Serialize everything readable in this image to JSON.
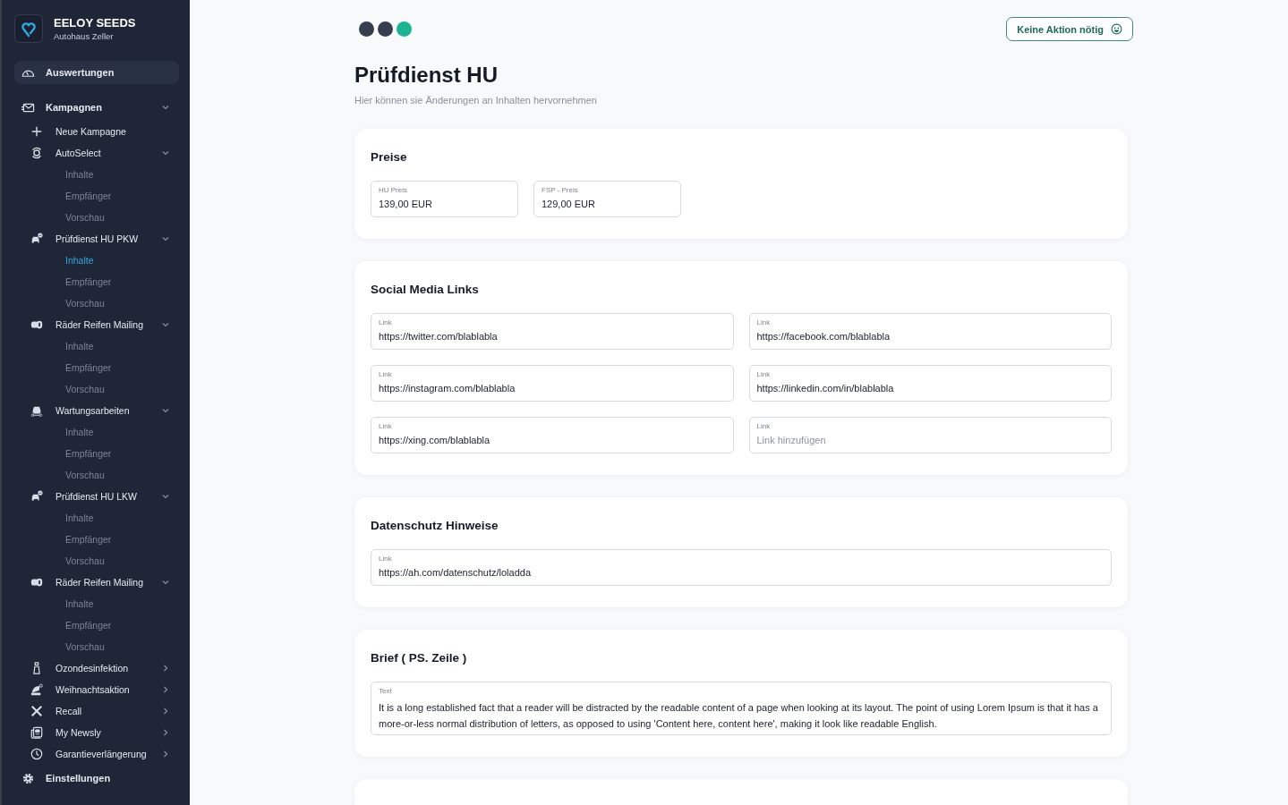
{
  "sidebar": {
    "brand": {
      "name": "EELOY SEEDS",
      "subtitle": "Autohaus Zeller"
    },
    "items": [
      {
        "label": "Auswertungen",
        "selected": true
      },
      {
        "label": "Kampagnen",
        "selected": false,
        "expanded": true,
        "children": [
          {
            "label": "Neue Kampagne"
          },
          {
            "label": "AutoSelect",
            "expanded": true,
            "children": [
              {
                "label": "Inhalte",
                "selected": false
              },
              {
                "label": "Empfänger",
                "selected": false
              },
              {
                "label": "Vorschau",
                "selected": false
              }
            ]
          },
          {
            "label": "Prüfdienst HU PKW",
            "expanded": true,
            "children": [
              {
                "label": "Inhalte",
                "selected": true
              },
              {
                "label": "Empfänger",
                "selected": false
              },
              {
                "label": "Vorschau",
                "selected": false
              }
            ]
          },
          {
            "label": "Räder Reifen Mailing",
            "expanded": true,
            "children": [
              {
                "label": "Inhalte",
                "selected": false
              },
              {
                "label": "Empfänger",
                "selected": false
              },
              {
                "label": "Vorschau",
                "selected": false
              }
            ]
          },
          {
            "label": "Wartungsarbeiten",
            "expanded": true,
            "children": [
              {
                "label": "Inhalte",
                "selected": false
              },
              {
                "label": "Empfänger",
                "selected": false
              },
              {
                "label": "Vorschau",
                "selected": false
              }
            ]
          },
          {
            "label": "Prüfdienst HU LKW",
            "expanded": true,
            "children": [
              {
                "label": "Inhalte",
                "selected": false
              },
              {
                "label": "Empfänger",
                "selected": false
              },
              {
                "label": "Vorschau",
                "selected": false
              }
            ]
          },
          {
            "label": "Räder Reifen Mailing",
            "expanded": true,
            "children": [
              {
                "label": "Inhalte",
                "selected": false
              },
              {
                "label": "Empfänger",
                "selected": false
              },
              {
                "label": "Vorschau",
                "selected": false
              }
            ]
          },
          {
            "label": "Ozondesinfektion",
            "expanded": false
          },
          {
            "label": "Weihnachtsaktion",
            "expanded": false
          },
          {
            "label": "Recall",
            "expanded": false
          },
          {
            "label": "My Newsly",
            "expanded": false
          },
          {
            "label": "Garantieverlängerung",
            "expanded": false
          }
        ]
      },
      {
        "label": "Einstellungen",
        "selected": false
      }
    ]
  },
  "steps": [
    {
      "done": true,
      "current": false
    },
    {
      "done": true,
      "current": false
    },
    {
      "done": false,
      "current": true
    }
  ],
  "status_button": {
    "label": "Keine Aktion nötig"
  },
  "page": {
    "title": "Prüfdienst HU",
    "subtitle": "Hier können sie Änderungen an Inhalten hervornehmen"
  },
  "cards": [
    {
      "title": "Preise",
      "kind": "prices",
      "fields": [
        {
          "label": "HU Preis",
          "value": "139,00 EUR"
        },
        {
          "label": "FSP -  Preis",
          "value": "129,00 EUR"
        }
      ]
    },
    {
      "title": "Social Media Links",
      "kind": "grid",
      "fields": [
        {
          "label": "Link",
          "value": "https://twitter.com/blablabla"
        },
        {
          "label": "Link",
          "value": "https://facebook.com/blablabla"
        },
        {
          "label": "Link",
          "value": "https://instagram.com/blablabla"
        },
        {
          "label": "Link",
          "value": "https://linkedin.com/in/blablabla"
        },
        {
          "label": "Link",
          "value": "https://xing.com/blablabla"
        },
        {
          "label": "Link",
          "placeholder": "Link hinzufügen"
        }
      ]
    },
    {
      "title": "Datenschutz Hinweise",
      "kind": "full",
      "fields": [
        {
          "label": "Link",
          "value": "https://ah.com/datenschutz/loladda"
        }
      ]
    },
    {
      "title": "Brief ( PS. Zeile )",
      "kind": "text",
      "fields": [
        {
          "label": "Text",
          "value": "It is a long established fact that a reader will be distracted by the readable content of a page when looking at its layout. The point of using Lorem Ipsum is that it has a more-or-less normal distribution of letters, as opposed to using 'Content here, content here', making it look like readable English."
        }
      ]
    },
    {
      "kind": "cut"
    }
  ]
}
